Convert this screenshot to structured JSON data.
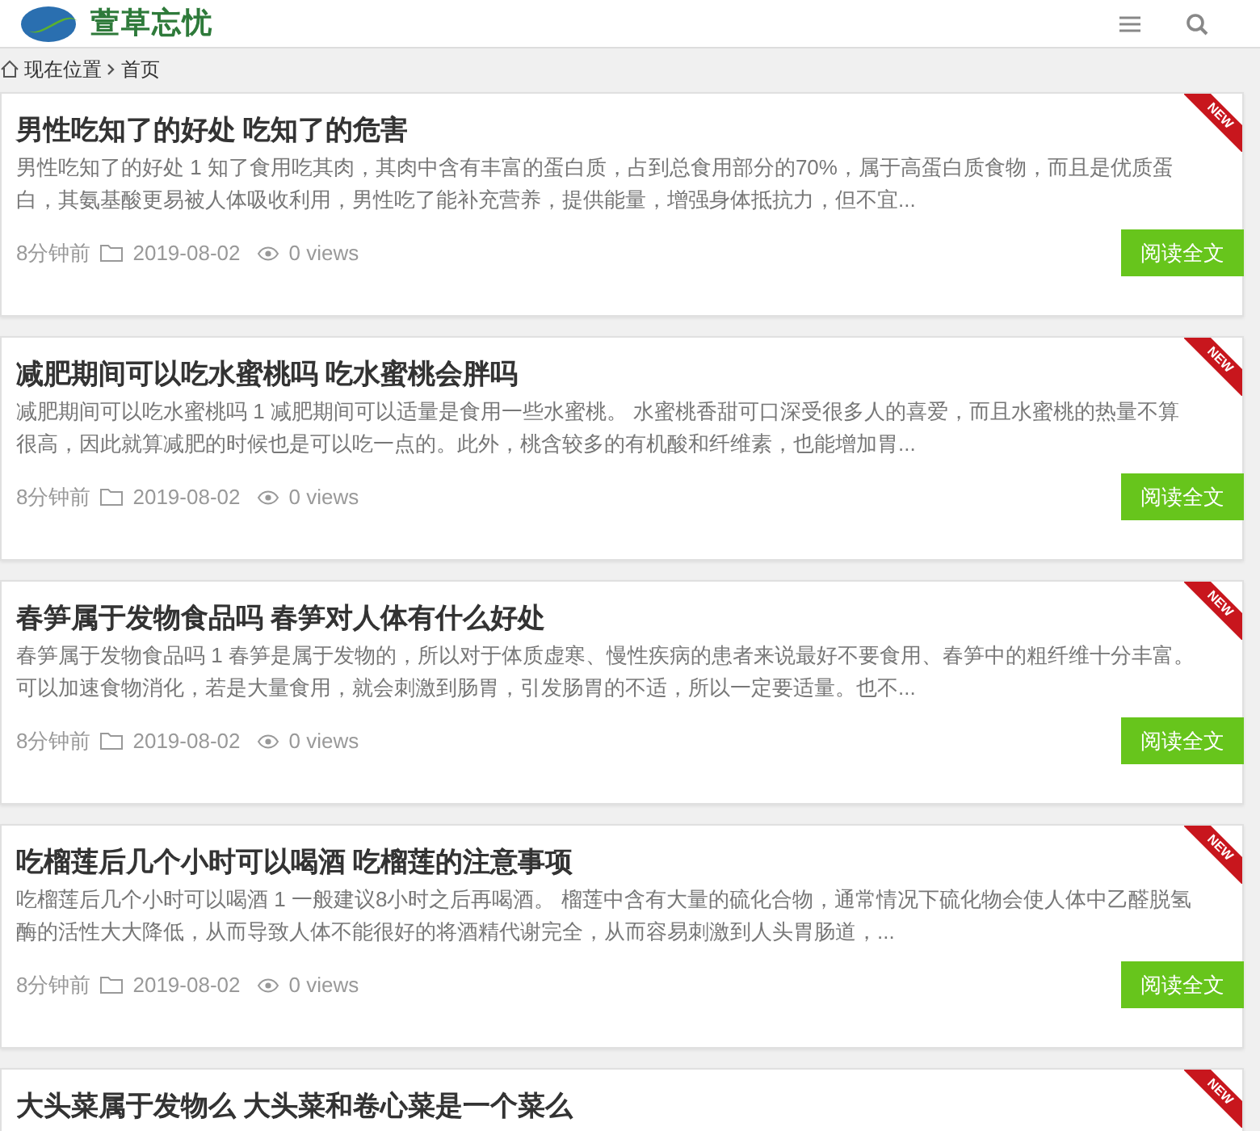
{
  "header": {
    "logo_text": "萱草忘忧"
  },
  "breadcrumb": {
    "items": [
      "现在位置",
      "首页"
    ]
  },
  "posts": [
    {
      "title": "男性吃知了的好处 吃知了的危害",
      "excerpt": "男性吃知了的好处 1 知了食用吃其肉，其肉中含有丰富的蛋白质，占到总食用部分的70%，属于高蛋白质食物，而且是优质蛋白，其氨基酸更易被人体吸收利用，男性吃了能补充营养，提供能量，增强身体抵抗力，但不宜...",
      "time": "8分钟前",
      "date": "2019-08-02",
      "views": "0 views",
      "button": "阅读全文",
      "badge": "NEW"
    },
    {
      "title": "减肥期间可以吃水蜜桃吗 吃水蜜桃会胖吗",
      "excerpt": "减肥期间可以吃水蜜桃吗 1 减肥期间可以适量是食用一些水蜜桃。 水蜜桃香甜可口深受很多人的喜爱，而且水蜜桃的热量不算很高，因此就算减肥的时候也是可以吃一点的。此外，桃含较多的有机酸和纤维素，也能增加胃...",
      "time": "8分钟前",
      "date": "2019-08-02",
      "views": "0 views",
      "button": "阅读全文",
      "badge": "NEW"
    },
    {
      "title": "春笋属于发物食品吗 春笋对人体有什么好处",
      "excerpt": "春笋属于发物食品吗 1 春笋是属于发物的，所以对于体质虚寒、慢性疾病的患者来说最好不要食用、春笋中的粗纤维十分丰富。可以加速食物消化，若是大量食用，就会刺激到肠胃，引发肠胃的不适，所以一定要适量。也不...",
      "time": "8分钟前",
      "date": "2019-08-02",
      "views": "0 views",
      "button": "阅读全文",
      "badge": "NEW"
    },
    {
      "title": "吃榴莲后几个小时可以喝酒 吃榴莲的注意事项",
      "excerpt": "吃榴莲后几个小时可以喝酒 1 一般建议8小时之后再喝酒。 榴莲中含有大量的硫化合物，通常情况下硫化物会使人体中乙醛脱氢酶的活性大大降低，从而导致人体不能很好的将酒精代谢完全，从而容易刺激到人头胃肠道，...",
      "time": "8分钟前",
      "date": "2019-08-02",
      "views": "0 views",
      "button": "阅读全文",
      "badge": "NEW"
    },
    {
      "title": "大头菜属于发物么 大头菜和卷心菜是一个菜么",
      "badge": "NEW"
    }
  ]
}
